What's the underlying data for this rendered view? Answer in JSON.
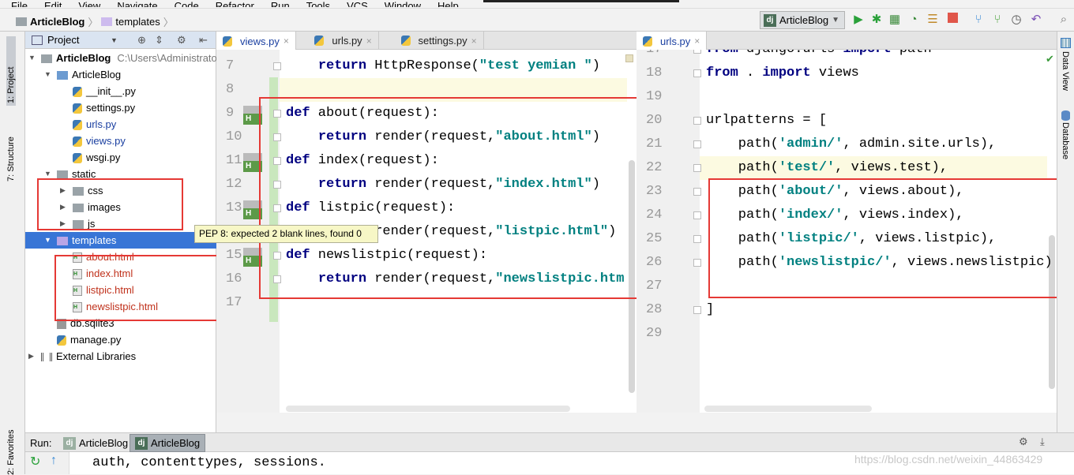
{
  "menu": [
    "File",
    "Edit",
    "View",
    "Navigate",
    "Code",
    "Refactor",
    "Run",
    "Tools",
    "VCS",
    "Window",
    "Help"
  ],
  "breadcrumb": [
    "ArticleBlog",
    "templates"
  ],
  "toolbar": {
    "run_config": "ArticleBlog",
    "icons": [
      "run-icon",
      "debug-icon",
      "coverage-icon",
      "profile-icon",
      "concurrency-icon",
      "stop-icon",
      "vcs-update-icon",
      "vcs-commit-icon",
      "history-icon",
      "revert-icon",
      "search-icon"
    ]
  },
  "left_strip": {
    "project": "1: Project",
    "structure": "7: Structure",
    "favorites": "2: Favorites"
  },
  "right_strip": {
    "data_view": "Data View",
    "database": "Database"
  },
  "project_panel": {
    "title": "Project",
    "tree": [
      {
        "label": "ArticleBlog",
        "note": "C:\\Users\\Administrato",
        "type": "folder",
        "depth": 0,
        "open": true,
        "bold": true
      },
      {
        "label": "ArticleBlog",
        "type": "folder",
        "depth": 1,
        "open": true
      },
      {
        "label": "__init__.py",
        "type": "py",
        "depth": 2
      },
      {
        "label": "settings.py",
        "type": "py",
        "depth": 2
      },
      {
        "label": "urls.py",
        "type": "py",
        "depth": 2,
        "modified": true
      },
      {
        "label": "views.py",
        "type": "py",
        "depth": 2,
        "modified": true
      },
      {
        "label": "wsgi.py",
        "type": "py",
        "depth": 2
      },
      {
        "label": "static",
        "type": "folder",
        "depth": 1,
        "open": true
      },
      {
        "label": "css",
        "type": "folder",
        "depth": 2,
        "open": false
      },
      {
        "label": "images",
        "type": "folder",
        "depth": 2,
        "open": false
      },
      {
        "label": "js",
        "type": "folder",
        "depth": 2,
        "open": false
      },
      {
        "label": "templates",
        "type": "folder-purple",
        "depth": 1,
        "open": true,
        "selected": true
      },
      {
        "label": "about.html",
        "type": "html",
        "depth": 2,
        "new": true
      },
      {
        "label": "index.html",
        "type": "html",
        "depth": 2,
        "new": true
      },
      {
        "label": "listpic.html",
        "type": "html",
        "depth": 2,
        "new": true
      },
      {
        "label": "newslistpic.html",
        "type": "html",
        "depth": 2,
        "new": true
      },
      {
        "label": "db.sqlite3",
        "type": "db",
        "depth": 1
      },
      {
        "label": "manage.py",
        "type": "py",
        "depth": 1
      },
      {
        "label": "External Libraries",
        "type": "lib",
        "depth": 0,
        "open": false
      }
    ]
  },
  "left_editor": {
    "tabs": [
      {
        "label": "views.py",
        "active": true
      },
      {
        "label": "urls.py"
      },
      {
        "label": "settings.py"
      }
    ],
    "first_line": 7,
    "caret_line": 8,
    "lines": [
      [
        [
          "n",
          "    "
        ],
        [
          "k",
          "return"
        ],
        [
          "n",
          " HttpResponse("
        ],
        [
          "s",
          "\"test yemian \""
        ],
        [
          "n",
          ")"
        ]
      ],
      [],
      [
        [
          "k",
          "def"
        ],
        [
          "n",
          " about(request):"
        ]
      ],
      [
        [
          "n",
          "    "
        ],
        [
          "k",
          "return"
        ],
        [
          "n",
          " render(request,"
        ],
        [
          "s",
          "\"about.html\""
        ],
        [
          "n",
          ")"
        ]
      ],
      [
        [
          "k",
          "def"
        ],
        [
          "n",
          " index(request):"
        ]
      ],
      [
        [
          "n",
          "    "
        ],
        [
          "k",
          "return"
        ],
        [
          "n",
          " render(request,"
        ],
        [
          "s",
          "\"index.html\""
        ],
        [
          "n",
          ")"
        ]
      ],
      [
        [
          "k",
          "def"
        ],
        [
          "n",
          " listpic(request):"
        ]
      ],
      [
        [
          "n",
          "    "
        ],
        [
          "k",
          "return"
        ],
        [
          "n",
          " render(request,"
        ],
        [
          "s",
          "\"listpic.html\""
        ],
        [
          "n",
          ")"
        ]
      ],
      [
        [
          "k",
          "def"
        ],
        [
          "n",
          " newslistpic(request):"
        ]
      ],
      [
        [
          "n",
          "    "
        ],
        [
          "k",
          "return"
        ],
        [
          "n",
          " render(request,"
        ],
        [
          "s",
          "\"newslistpic.htm"
        ]
      ],
      []
    ],
    "tooltip": "PEP 8: expected 2 blank lines, found 0"
  },
  "right_editor": {
    "tabs": [
      {
        "label": "urls.py",
        "active": true
      }
    ],
    "first_line": 17,
    "caret_line": 22,
    "lines": [
      [
        [
          "k",
          "from"
        ],
        [
          "n",
          " django.urls "
        ],
        [
          "k",
          "import"
        ],
        [
          "n",
          " path"
        ]
      ],
      [
        [
          "k",
          "from"
        ],
        [
          "n",
          " . "
        ],
        [
          "k",
          "import"
        ],
        [
          "n",
          " views"
        ]
      ],
      [],
      [
        [
          "n",
          "urlpatterns = ["
        ]
      ],
      [
        [
          "n",
          "    path("
        ],
        [
          "s",
          "'admin/'"
        ],
        [
          "n",
          ", admin.site.urls),"
        ]
      ],
      [
        [
          "n",
          "    path("
        ],
        [
          "s",
          "'test/'"
        ],
        [
          "n",
          ", views.test),"
        ]
      ],
      [
        [
          "n",
          "    path("
        ],
        [
          "s",
          "'about/'"
        ],
        [
          "n",
          ", views.about),"
        ]
      ],
      [
        [
          "n",
          "    path("
        ],
        [
          "s",
          "'index/'"
        ],
        [
          "n",
          ", views.index),"
        ]
      ],
      [
        [
          "n",
          "    path("
        ],
        [
          "s",
          "'listpic/'"
        ],
        [
          "n",
          ", views.listpic),"
        ]
      ],
      [
        [
          "n",
          "    path("
        ],
        [
          "s",
          "'newslistpic/'"
        ],
        [
          "n",
          ", views.newslistpic)"
        ]
      ],
      [],
      [
        [
          "n",
          "]"
        ]
      ],
      []
    ]
  },
  "run_panel": {
    "label": "Run:",
    "tabs": [
      {
        "label": "ArticleBlog"
      },
      {
        "label": "ArticleBlog",
        "active": true
      }
    ],
    "console_text": "auth, contenttypes, sessions."
  },
  "watermark": "https://blog.csdn.net/weixin_44863429",
  "colors": {
    "keyword": "#000080",
    "string": "#008080",
    "selection": "#3875d6",
    "annotation_box": "#e53935",
    "caret_line": "#fcfae1"
  }
}
